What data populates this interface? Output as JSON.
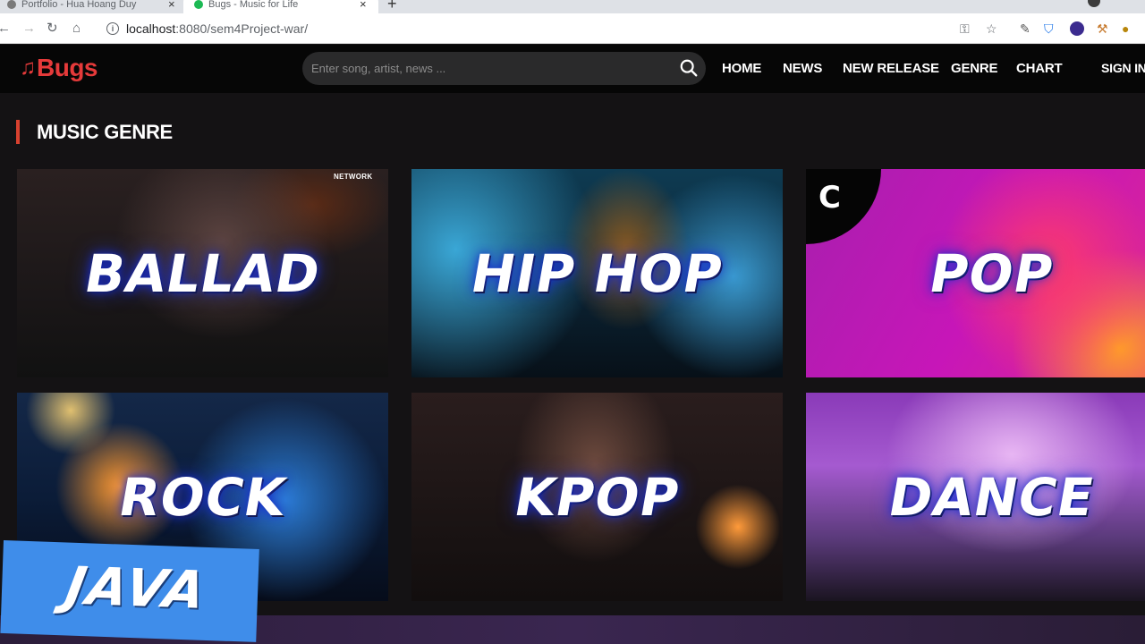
{
  "browser": {
    "tabs": [
      {
        "title": "Portfolio - Hua Hoang Duy"
      },
      {
        "title": "Bugs - Music for Life"
      }
    ],
    "url_host": "localhost",
    "url_path": ":8080/sem4Project-war/",
    "icons": {
      "back": "arrow-left-icon",
      "forward": "arrow-right-icon",
      "reload": "reload-icon",
      "home": "home-icon",
      "info": "info-icon",
      "key": "key-icon",
      "star": "star-icon"
    }
  },
  "header": {
    "logo_text": "Bugs",
    "search_placeholder": "Enter song, artist, news ...",
    "nav": {
      "home": "HOME",
      "news": "NEWS",
      "new_release": "NEW RELEASE",
      "genre": "GENRE",
      "chart": "CHART",
      "sign_in": "SIGN IN"
    }
  },
  "section": {
    "title": "MUSIC GENRE"
  },
  "genres": [
    {
      "label": "BALLAD",
      "badge": "NETWORK"
    },
    {
      "label": "HIP HOP"
    },
    {
      "label": "POP"
    },
    {
      "label": "ROCK"
    },
    {
      "label": "KPOP"
    },
    {
      "label": "DANCE"
    }
  ],
  "overlay": {
    "banner_text": "JAVA"
  },
  "colors": {
    "brand": "#e53a3a",
    "accent_bar": "#d8412f",
    "header_bg": "#060606",
    "page_bg": "#141214",
    "banner": "#3f8dea"
  }
}
